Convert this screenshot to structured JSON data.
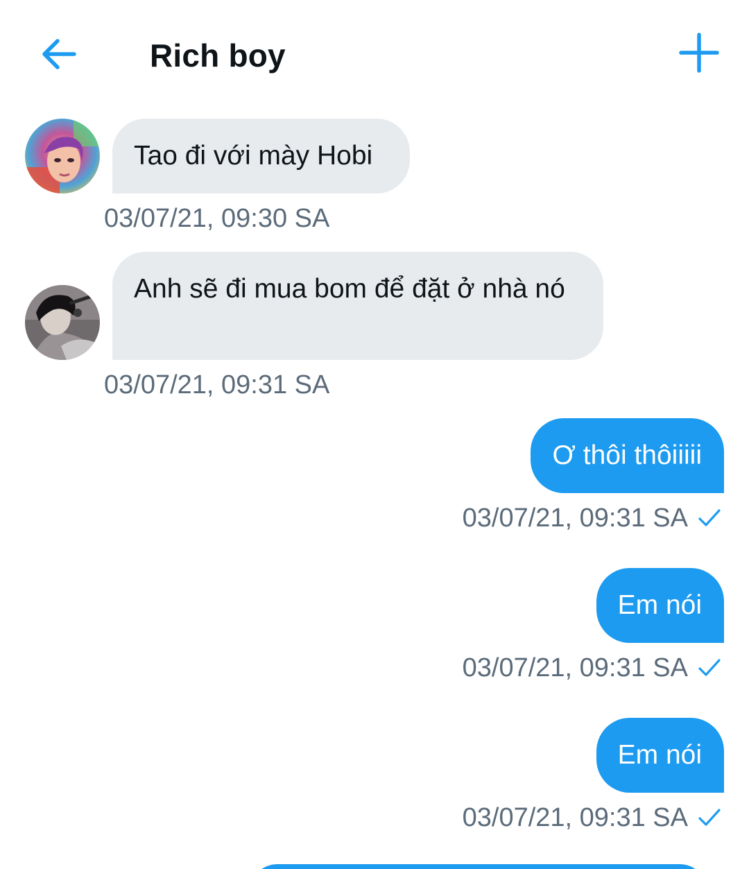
{
  "header": {
    "title": "Rich boy",
    "back_icon": "arrow-left-icon",
    "add_icon": "plus-icon",
    "accent_color": "#1d9bf0"
  },
  "messages": [
    {
      "direction": "incoming",
      "avatar": "avatar-colorful",
      "text": "Tao đi với mày Hobi",
      "timestamp": "03/07/21, 09:30 SA"
    },
    {
      "direction": "incoming",
      "avatar": "avatar-dark",
      "text": "Anh sẽ đi mua bom để đặt ở nhà nó",
      "timestamp": "03/07/21, 09:31 SA"
    },
    {
      "direction": "outgoing",
      "text": "Ơ thôi thôiiiii",
      "timestamp": "03/07/21, 09:31 SA",
      "status_icon": "check-icon"
    },
    {
      "direction": "outgoing",
      "text": "Em nói",
      "timestamp": "03/07/21, 09:31 SA",
      "status_icon": "check-icon"
    },
    {
      "direction": "outgoing",
      "text": "Em nói",
      "timestamp": "03/07/21, 09:31 SA",
      "status_icon": "check-icon"
    }
  ],
  "colors": {
    "incoming_bubble": "#e7ebee",
    "outgoing_bubble": "#1d9bf0",
    "timestamp": "#5b6b7a"
  }
}
